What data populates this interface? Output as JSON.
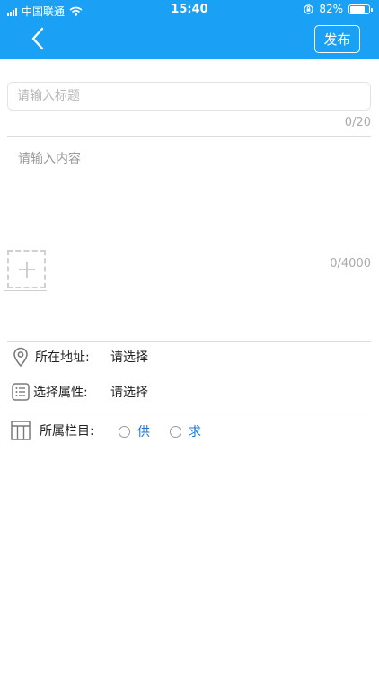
{
  "status_bar": {
    "carrier": "中国联通",
    "time": "15:40",
    "battery_percent": "82%",
    "battery_level": 0.82,
    "icons": [
      "signal-icon",
      "wifi-icon",
      "orientation-lock-icon",
      "battery-icon"
    ]
  },
  "header": {
    "background_color": "#1aa1f5",
    "back_icon": "chevron-left-icon",
    "publish_label": "发布"
  },
  "form": {
    "title_placeholder": "请输入标题",
    "title_count": "0/20",
    "content_placeholder": "请输入内容",
    "content_count": "0/4000",
    "add_image_icon": "plus-icon"
  },
  "address": {
    "icon": "location-pin-icon",
    "label": "所在地址:",
    "value": "请选择"
  },
  "attribute": {
    "icon": "list-icon",
    "label": "选择属性:",
    "value": "请选择"
  },
  "column": {
    "icon": "table-icon",
    "label": "所属栏目:",
    "options": [
      {
        "label": "供",
        "selected": false
      },
      {
        "label": "求",
        "selected": false
      }
    ],
    "option_color": "#1a73d9"
  }
}
